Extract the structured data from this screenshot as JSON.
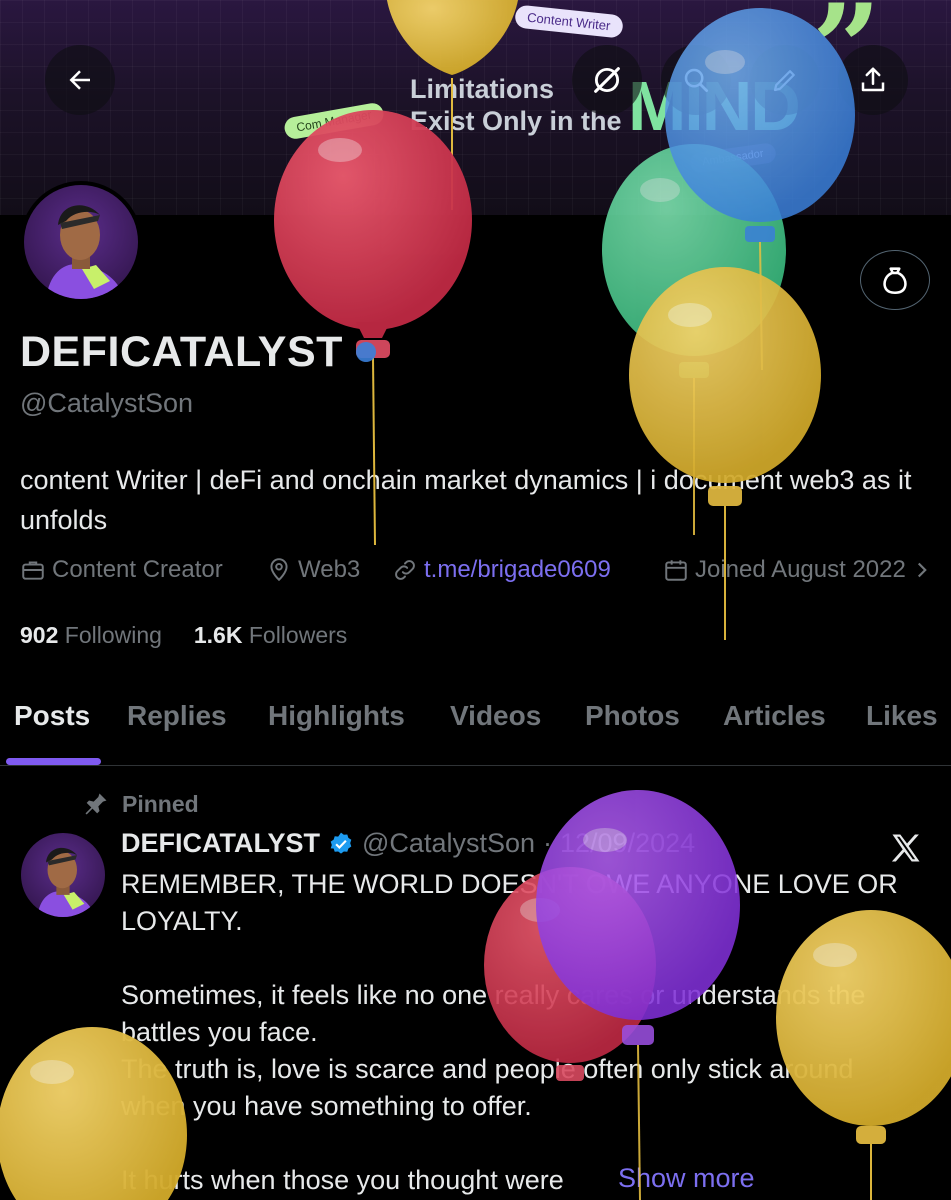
{
  "banner": {
    "tag_content_writer": "Content Writer",
    "tag_com_manager": "Com Manager",
    "tag_ambassador": "Ambassador",
    "slogan_line1": "Limitations",
    "slogan_line2": "Exist Only in the",
    "slogan_mind": "MIND"
  },
  "header_buttons": {
    "back_icon": "arrow-left-icon",
    "grok_icon": "grok-icon",
    "search_icon": "search-icon",
    "edit_icon": "pencil-icon",
    "share_icon": "share-icon"
  },
  "profile": {
    "display_name": "DEFICATALYST",
    "handle": "@CatalystSon",
    "bio": "content Writer | deFi and onchain market dynamics | i document web3 as it unfolds",
    "category": "Content Creator",
    "location": "Web3",
    "link": "t.me/brigade0609",
    "joined": "Joined August 2022",
    "following_count": "902",
    "following_label": "Following",
    "followers_count": "1.6K",
    "followers_label": "Followers"
  },
  "tabs": [
    {
      "label": "Posts",
      "active": true
    },
    {
      "label": "Replies"
    },
    {
      "label": "Highlights"
    },
    {
      "label": "Videos"
    },
    {
      "label": "Photos"
    },
    {
      "label": "Articles"
    },
    {
      "label": "Likes"
    }
  ],
  "pinned_post": {
    "pinned_label": "Pinned",
    "author_name": "DEFICATALYST",
    "author_handle": "@CatalystSon",
    "separator": "·",
    "date": "12/09/2024",
    "text": "REMEMBER, THE WORLD DOESN'T OWE ANYONE LOVE OR LOYALTY.\n\nSometimes, it feels like no one really cares or understands the battles you face.\nThe truth is, love is scarce and people often only stick around when you have something to offer.\n\nIt hurts when those you thought were",
    "show_more": "Show more"
  },
  "colors": {
    "accent": "#7f5af0",
    "link": "#7c6ff0",
    "muted": "#71767b",
    "verified": "#1d9bf0"
  }
}
